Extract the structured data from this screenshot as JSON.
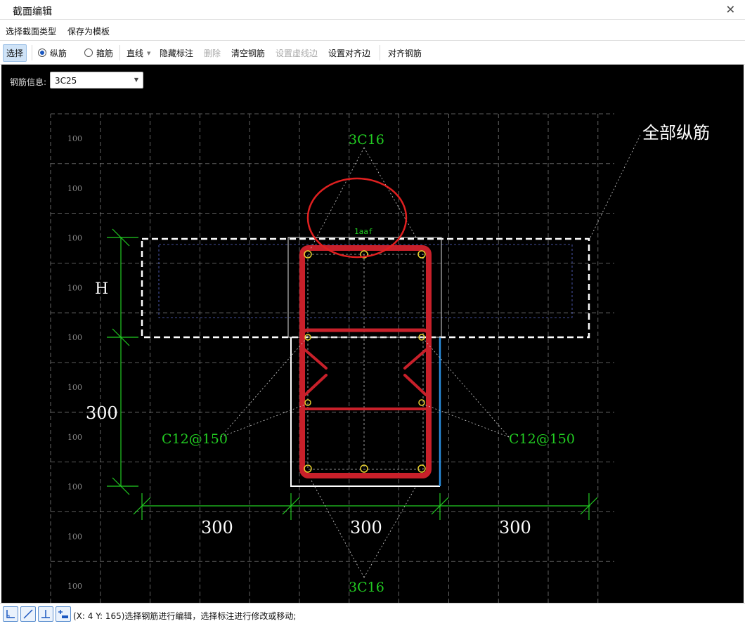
{
  "window": {
    "title": "截面编辑",
    "close_icon": "close-icon"
  },
  "menu": {
    "items": [
      "选择截面类型",
      "保存为模板"
    ]
  },
  "toolbar": {
    "select": "选择",
    "longitudinal": "纵筋",
    "stirrup": "箍筋",
    "line": "直线",
    "hide_labels": "隐藏标注",
    "delete": "删除",
    "clear_rebar": "清空钢筋",
    "set_dashed_edge": "设置虚线边",
    "set_align_edge": "设置对齐边",
    "align_rebar": "对齐钢筋"
  },
  "rebar_info": {
    "label": "钢筋信息:",
    "value": "3C25"
  },
  "drawing": {
    "grid_labels": [
      "100",
      "100",
      "100",
      "100",
      "100",
      "100",
      "100",
      "100",
      "100",
      "100"
    ],
    "top_bars": "3C16",
    "bottom_bars": "3C16",
    "all_longitudinal": "全部纵筋",
    "left_stirrup": "C12@150",
    "right_stirrup": "C12@150",
    "dim_h": "H",
    "dim_left": "300",
    "dim_bottom": [
      "300",
      "300",
      "300"
    ],
    "small_label": "1aaf",
    "colors": {
      "dimension": "#22cc22",
      "rebar": "#c8202a",
      "dashed": "#ffffff",
      "callout": "#e02020"
    }
  },
  "status": {
    "message": "(X: 4 Y: 165)选择钢筋进行编辑，选择标注进行修改或移动;"
  }
}
